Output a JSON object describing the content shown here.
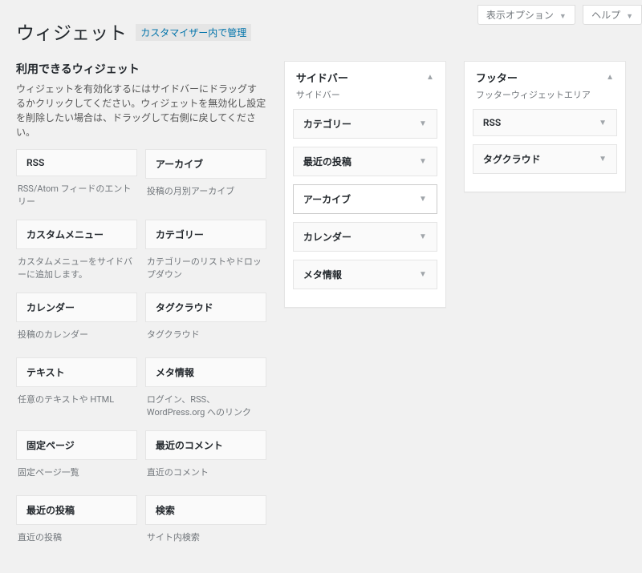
{
  "topTabs": {
    "displayOptions": "表示オプション",
    "help": "ヘルプ"
  },
  "header": {
    "title": "ウィジェット",
    "customizerLink": "カスタマイザー内で管理"
  },
  "available": {
    "heading": "利用できるウィジェット",
    "description": "ウィジェットを有効化するにはサイドバーにドラッグするかクリックしてください。ウィジェットを無効化し設定を削除したい場合は、ドラッグして右側に戻してください。",
    "items": [
      {
        "title": "RSS",
        "desc": "RSS/Atom フィードのエントリー"
      },
      {
        "title": "アーカイブ",
        "desc": "投稿の月別アーカイブ"
      },
      {
        "title": "カスタムメニュー",
        "desc": "カスタムメニューをサイドバーに追加します。"
      },
      {
        "title": "カテゴリー",
        "desc": "カテゴリーのリストやドロップダウン"
      },
      {
        "title": "カレンダー",
        "desc": "投稿のカレンダー"
      },
      {
        "title": "タグクラウド",
        "desc": "タグクラウド"
      },
      {
        "title": "テキスト",
        "desc": "任意のテキストや HTML"
      },
      {
        "title": "メタ情報",
        "desc": "ログイン、RSS、WordPress.org へのリンク"
      },
      {
        "title": "固定ページ",
        "desc": "固定ページ一覧"
      },
      {
        "title": "最近のコメント",
        "desc": "直近のコメント"
      },
      {
        "title": "最近の投稿",
        "desc": "直近の投稿"
      },
      {
        "title": "検索",
        "desc": "サイト内検索"
      }
    ]
  },
  "areas": {
    "sidebar": {
      "title": "サイドバー",
      "subtitle": "サイドバー",
      "widgets": [
        {
          "label": "カテゴリー"
        },
        {
          "label": "最近の投稿"
        },
        {
          "label": "アーカイブ",
          "placeholder": true
        },
        {
          "label": "カレンダー"
        },
        {
          "label": "メタ情報"
        }
      ]
    },
    "footer": {
      "title": "フッター",
      "subtitle": "フッターウィジェットエリア",
      "widgets": [
        {
          "label": "RSS"
        },
        {
          "label": "タグクラウド"
        }
      ]
    }
  }
}
